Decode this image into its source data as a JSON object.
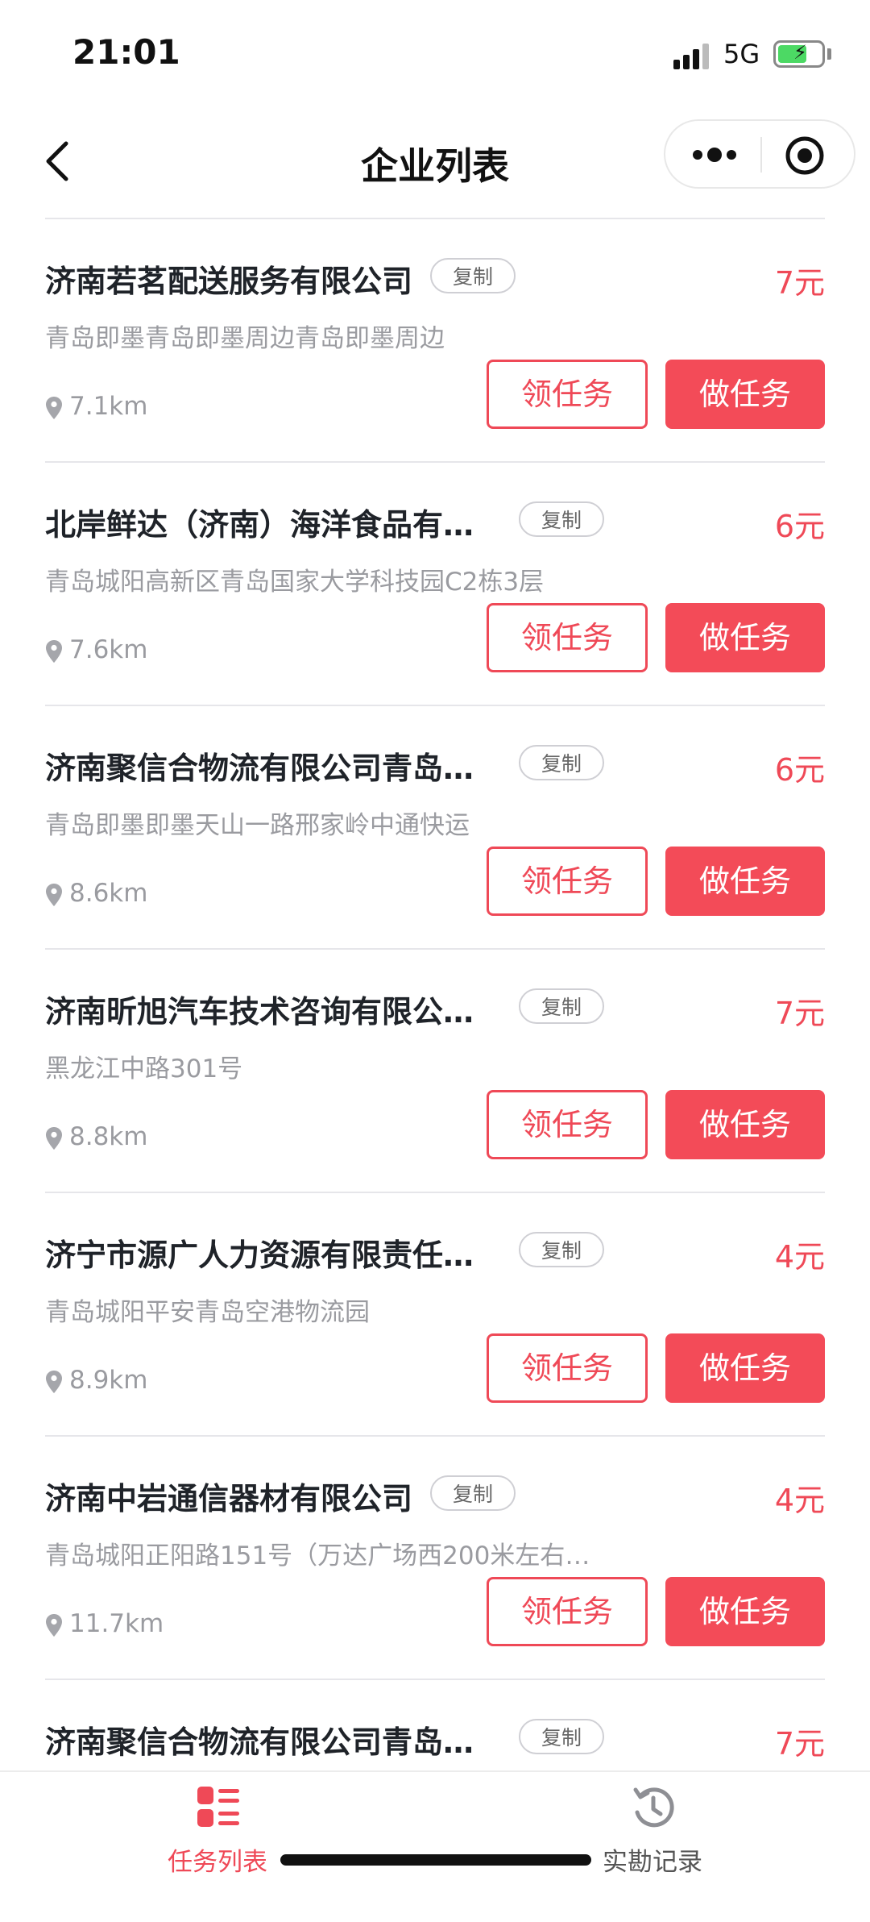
{
  "status_bar": {
    "time": "21:01",
    "network": "5G"
  },
  "nav": {
    "title": "企业列表"
  },
  "list": {
    "copy_label": "复制",
    "take_label": "领任务",
    "do_label": "做任务",
    "items": [
      {
        "name": "济南若茗配送服务有限公司",
        "price": "7元",
        "address": "青岛即墨青岛即墨周边青岛即墨周边",
        "distance": "7.1km"
      },
      {
        "name": "北岸鲜达（济南）海洋食品有…",
        "price": "6元",
        "address": "青岛城阳高新区青岛国家大学科技园C2栋3层",
        "distance": "7.6km"
      },
      {
        "name": "济南聚信合物流有限公司青岛…",
        "price": "6元",
        "address": "青岛即墨即墨天山一路邢家岭中通快运",
        "distance": "8.6km"
      },
      {
        "name": "济南昕旭汽车技术咨询有限公…",
        "price": "7元",
        "address": "黑龙江中路301号",
        "distance": "8.8km"
      },
      {
        "name": "济宁市源广人力资源有限责任…",
        "price": "4元",
        "address": "青岛城阳平安青岛空港物流园",
        "distance": "8.9km"
      },
      {
        "name": "济南中岩通信器材有限公司",
        "price": "4元",
        "address": "青岛城阳正阳路151号（万达广场西200米左右…",
        "distance": "11.7km"
      },
      {
        "name": "济南聚信合物流有限公司青岛…",
        "price": "7元",
        "address": "",
        "distance": ""
      }
    ]
  },
  "tab_bar": {
    "tasks_label": "任务列表",
    "records_label": "实勘记录"
  },
  "colors": {
    "accent": "#f34b58",
    "muted_text": "#9a9ba0"
  }
}
